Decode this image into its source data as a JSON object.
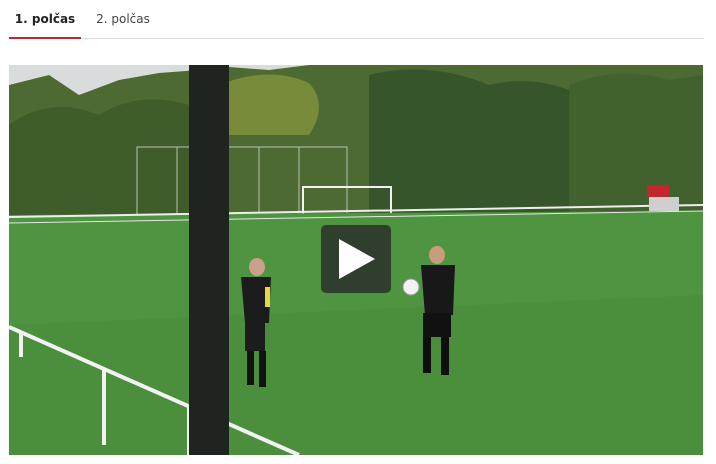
{
  "tabs": [
    {
      "label": "1. polčas",
      "active": true
    },
    {
      "label": "2. polčas",
      "active": false
    }
  ],
  "video": {
    "play_icon": "play-icon",
    "accent_color": "#c0282d"
  }
}
